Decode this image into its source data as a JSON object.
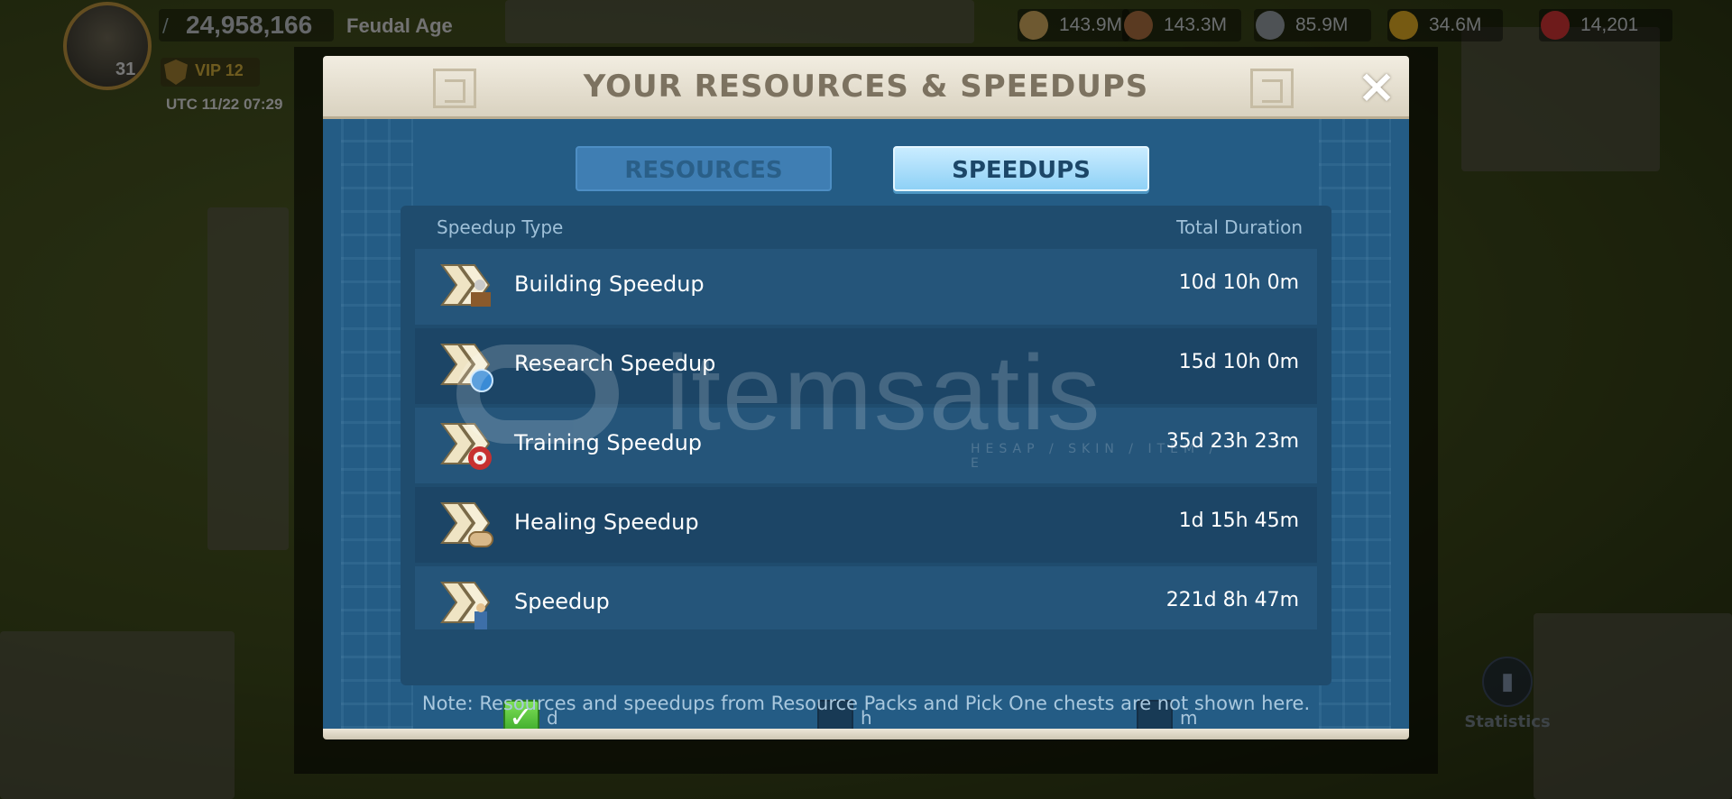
{
  "hud": {
    "avatar_level": "31",
    "power": "24,958,166",
    "age": "Feudal Age",
    "vip": "VIP 12",
    "utc": "UTC 11/22 07:29",
    "resources": [
      {
        "icon": "food-icon",
        "value": "143.9M",
        "color": "#c9a25a"
      },
      {
        "icon": "wood-icon",
        "value": "143.3M",
        "color": "#a56a3c"
      },
      {
        "icon": "stone-icon",
        "value": "85.9M",
        "color": "#8f969b"
      },
      {
        "icon": "gold-icon",
        "value": "34.6M",
        "color": "#d8a521"
      },
      {
        "icon": "gem-icon",
        "value": "14,201",
        "color": "#c93232"
      }
    ],
    "statistics_label": "Statistics"
  },
  "modal": {
    "title": "YOUR RESOURCES & SPEEDUPS",
    "close_icon": "close-icon",
    "tabs": [
      {
        "label": "RESOURCES",
        "active": false
      },
      {
        "label": "SPEEDUPS",
        "active": true
      }
    ],
    "columns": {
      "type": "Speedup Type",
      "duration": "Total Duration"
    },
    "rows": [
      {
        "icon": "building-speedup-icon",
        "label": "Building Speedup",
        "duration": "10d 10h 0m"
      },
      {
        "icon": "research-speedup-icon",
        "label": "Research Speedup",
        "duration": "15d 10h 0m"
      },
      {
        "icon": "training-speedup-icon",
        "label": "Training Speedup",
        "duration": "35d 23h 23m"
      },
      {
        "icon": "healing-speedup-icon",
        "label": "Healing Speedup",
        "duration": "1d 15h 45m"
      },
      {
        "icon": "universal-speedup-icon",
        "label": "Speedup",
        "duration": "221d 8h 47m"
      }
    ],
    "units": [
      {
        "label": "d",
        "checked": true
      },
      {
        "label": "h",
        "checked": false
      },
      {
        "label": "m",
        "checked": false
      }
    ],
    "note": "Note: Resources and speedups from Resource Packs and Pick One chests are not shown here."
  },
  "watermark": {
    "text": "itemsatis",
    "sub": "HESAP / SKIN / ITEM / E"
  },
  "colors": {
    "panel_blue": "#245c85",
    "tab_active": "#8fd1f6",
    "check_green": "#3aa828"
  }
}
